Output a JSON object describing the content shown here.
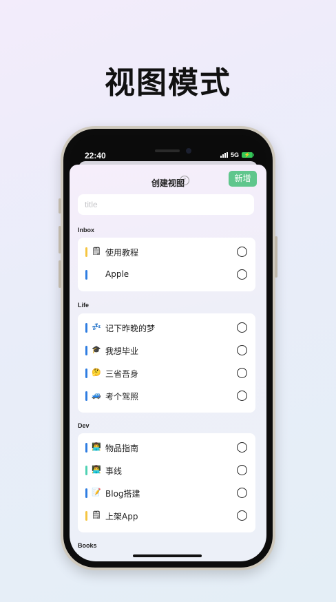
{
  "headline": "视图模式",
  "status": {
    "time": "22:40",
    "network": "5G"
  },
  "sheet": {
    "title": "创建视图",
    "help_glyph": "?",
    "add_label": "新增",
    "title_placeholder": "title",
    "title_value": ""
  },
  "groups": [
    {
      "label": "Inbox",
      "items": [
        {
          "icon": "memo-icon",
          "glyph": "🗒",
          "label": "使用教程",
          "color": "#f5c542",
          "checked": false
        },
        {
          "icon": "apple-icon",
          "glyph": "",
          "label": "Apple",
          "color": "#2f7de1",
          "checked": false
        }
      ]
    },
    {
      "label": "Life",
      "items": [
        {
          "icon": "sleep-icon",
          "glyph": "💤",
          "label": "记下昨晚的梦",
          "color": "#2f7de1",
          "checked": false
        },
        {
          "icon": "graduation-cap-icon",
          "glyph": "🎓",
          "label": "我想毕业",
          "color": "#2f7de1",
          "checked": false
        },
        {
          "icon": "thinking-face-icon",
          "glyph": "🤔",
          "label": "三省吾身",
          "color": "#2f7de1",
          "checked": false
        },
        {
          "icon": "car-icon",
          "glyph": "🚙",
          "label": "考个驾照",
          "color": "#2f7de1",
          "checked": false
        }
      ]
    },
    {
      "label": "Dev",
      "items": [
        {
          "icon": "technologist-icon",
          "glyph": "👨‍💻",
          "label": "物品指南",
          "color": "#2f7de1",
          "checked": false
        },
        {
          "icon": "technologist-icon",
          "glyph": "👨‍💻",
          "label": "事线",
          "color": "#4fd1b3",
          "checked": false
        },
        {
          "icon": "memo-icon",
          "glyph": "📝",
          "label": "Blog搭建",
          "color": "#2f7de1",
          "checked": false
        },
        {
          "icon": "memo-icon",
          "glyph": "🗒",
          "label": "上架App",
          "color": "#f5c542",
          "checked": false
        }
      ]
    },
    {
      "label": "Books",
      "items": []
    }
  ]
}
